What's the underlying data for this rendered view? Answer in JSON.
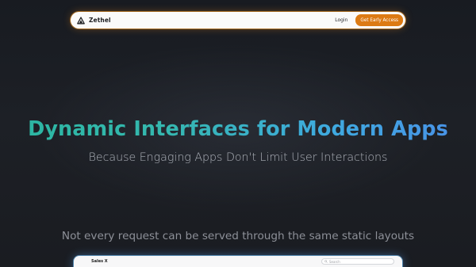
{
  "nav": {
    "brand": "Zethel",
    "logo_icon": "triangle-logo-icon",
    "login_label": "Login",
    "cta_label": "Get Early Access",
    "cta_color": "#dc7a14"
  },
  "hero": {
    "title": "Dynamic Interfaces for Modern Apps",
    "subtitle": "Because Engaging Apps Don't Limit User Interactions",
    "title_gradient": [
      "#2bb6a0",
      "#4a8fe8"
    ]
  },
  "section": {
    "text": "Not every request can be served through the same static layouts"
  },
  "preview": {
    "title": "Sales X",
    "search_placeholder": "Search"
  }
}
